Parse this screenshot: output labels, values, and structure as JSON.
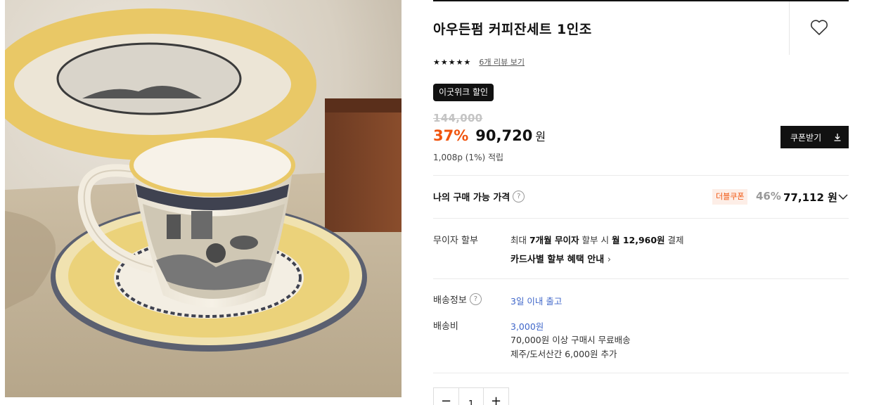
{
  "product": {
    "title": "아우든펌 커피잔세트 1인조",
    "rating_stars": 5,
    "review_link": "6개 리뷰 보기"
  },
  "promo_badge": "이굿위크 할인",
  "pricing": {
    "original": "144,000",
    "discount_rate": "37%",
    "sale_price": "90,720",
    "currency": "원",
    "points": "1,008p (1%) 적립",
    "coupon_button": "쿠폰받기"
  },
  "my_price": {
    "label": "나의 구매 가능 가격",
    "coupon_tag": "더블쿠폰",
    "discount_rate": "46%",
    "price": "77,112",
    "currency": "원"
  },
  "installment": {
    "label": "무이자 할부",
    "text_prefix": "최대 ",
    "months": "7개월 무이자",
    "text_mid": " 할부 시 ",
    "monthly": "월 12,960원",
    "text_suffix": " 결제",
    "card_link": "카드사별 할부 혜택 안내"
  },
  "shipping": {
    "info_label": "배송정보",
    "info_value": "3일 이내 출고",
    "fee_label": "배송비",
    "fee_value": "3,000원",
    "free_note": "70,000원 이상 구매시 무료배송",
    "island_note": "제주/도서산간 6,000원 추가"
  },
  "quantity": {
    "value": "1",
    "minus": "−",
    "plus": "+"
  },
  "icons": {
    "wish": "heart-outline-icon",
    "download": "download-icon",
    "help": "question-circle-icon",
    "chevron": "chevron-down-icon",
    "chevron_right": "chevron-right-icon"
  },
  "colors": {
    "accent": "#f0540e",
    "link_blue": "#3f66c9",
    "badge_bg": "#111111"
  }
}
